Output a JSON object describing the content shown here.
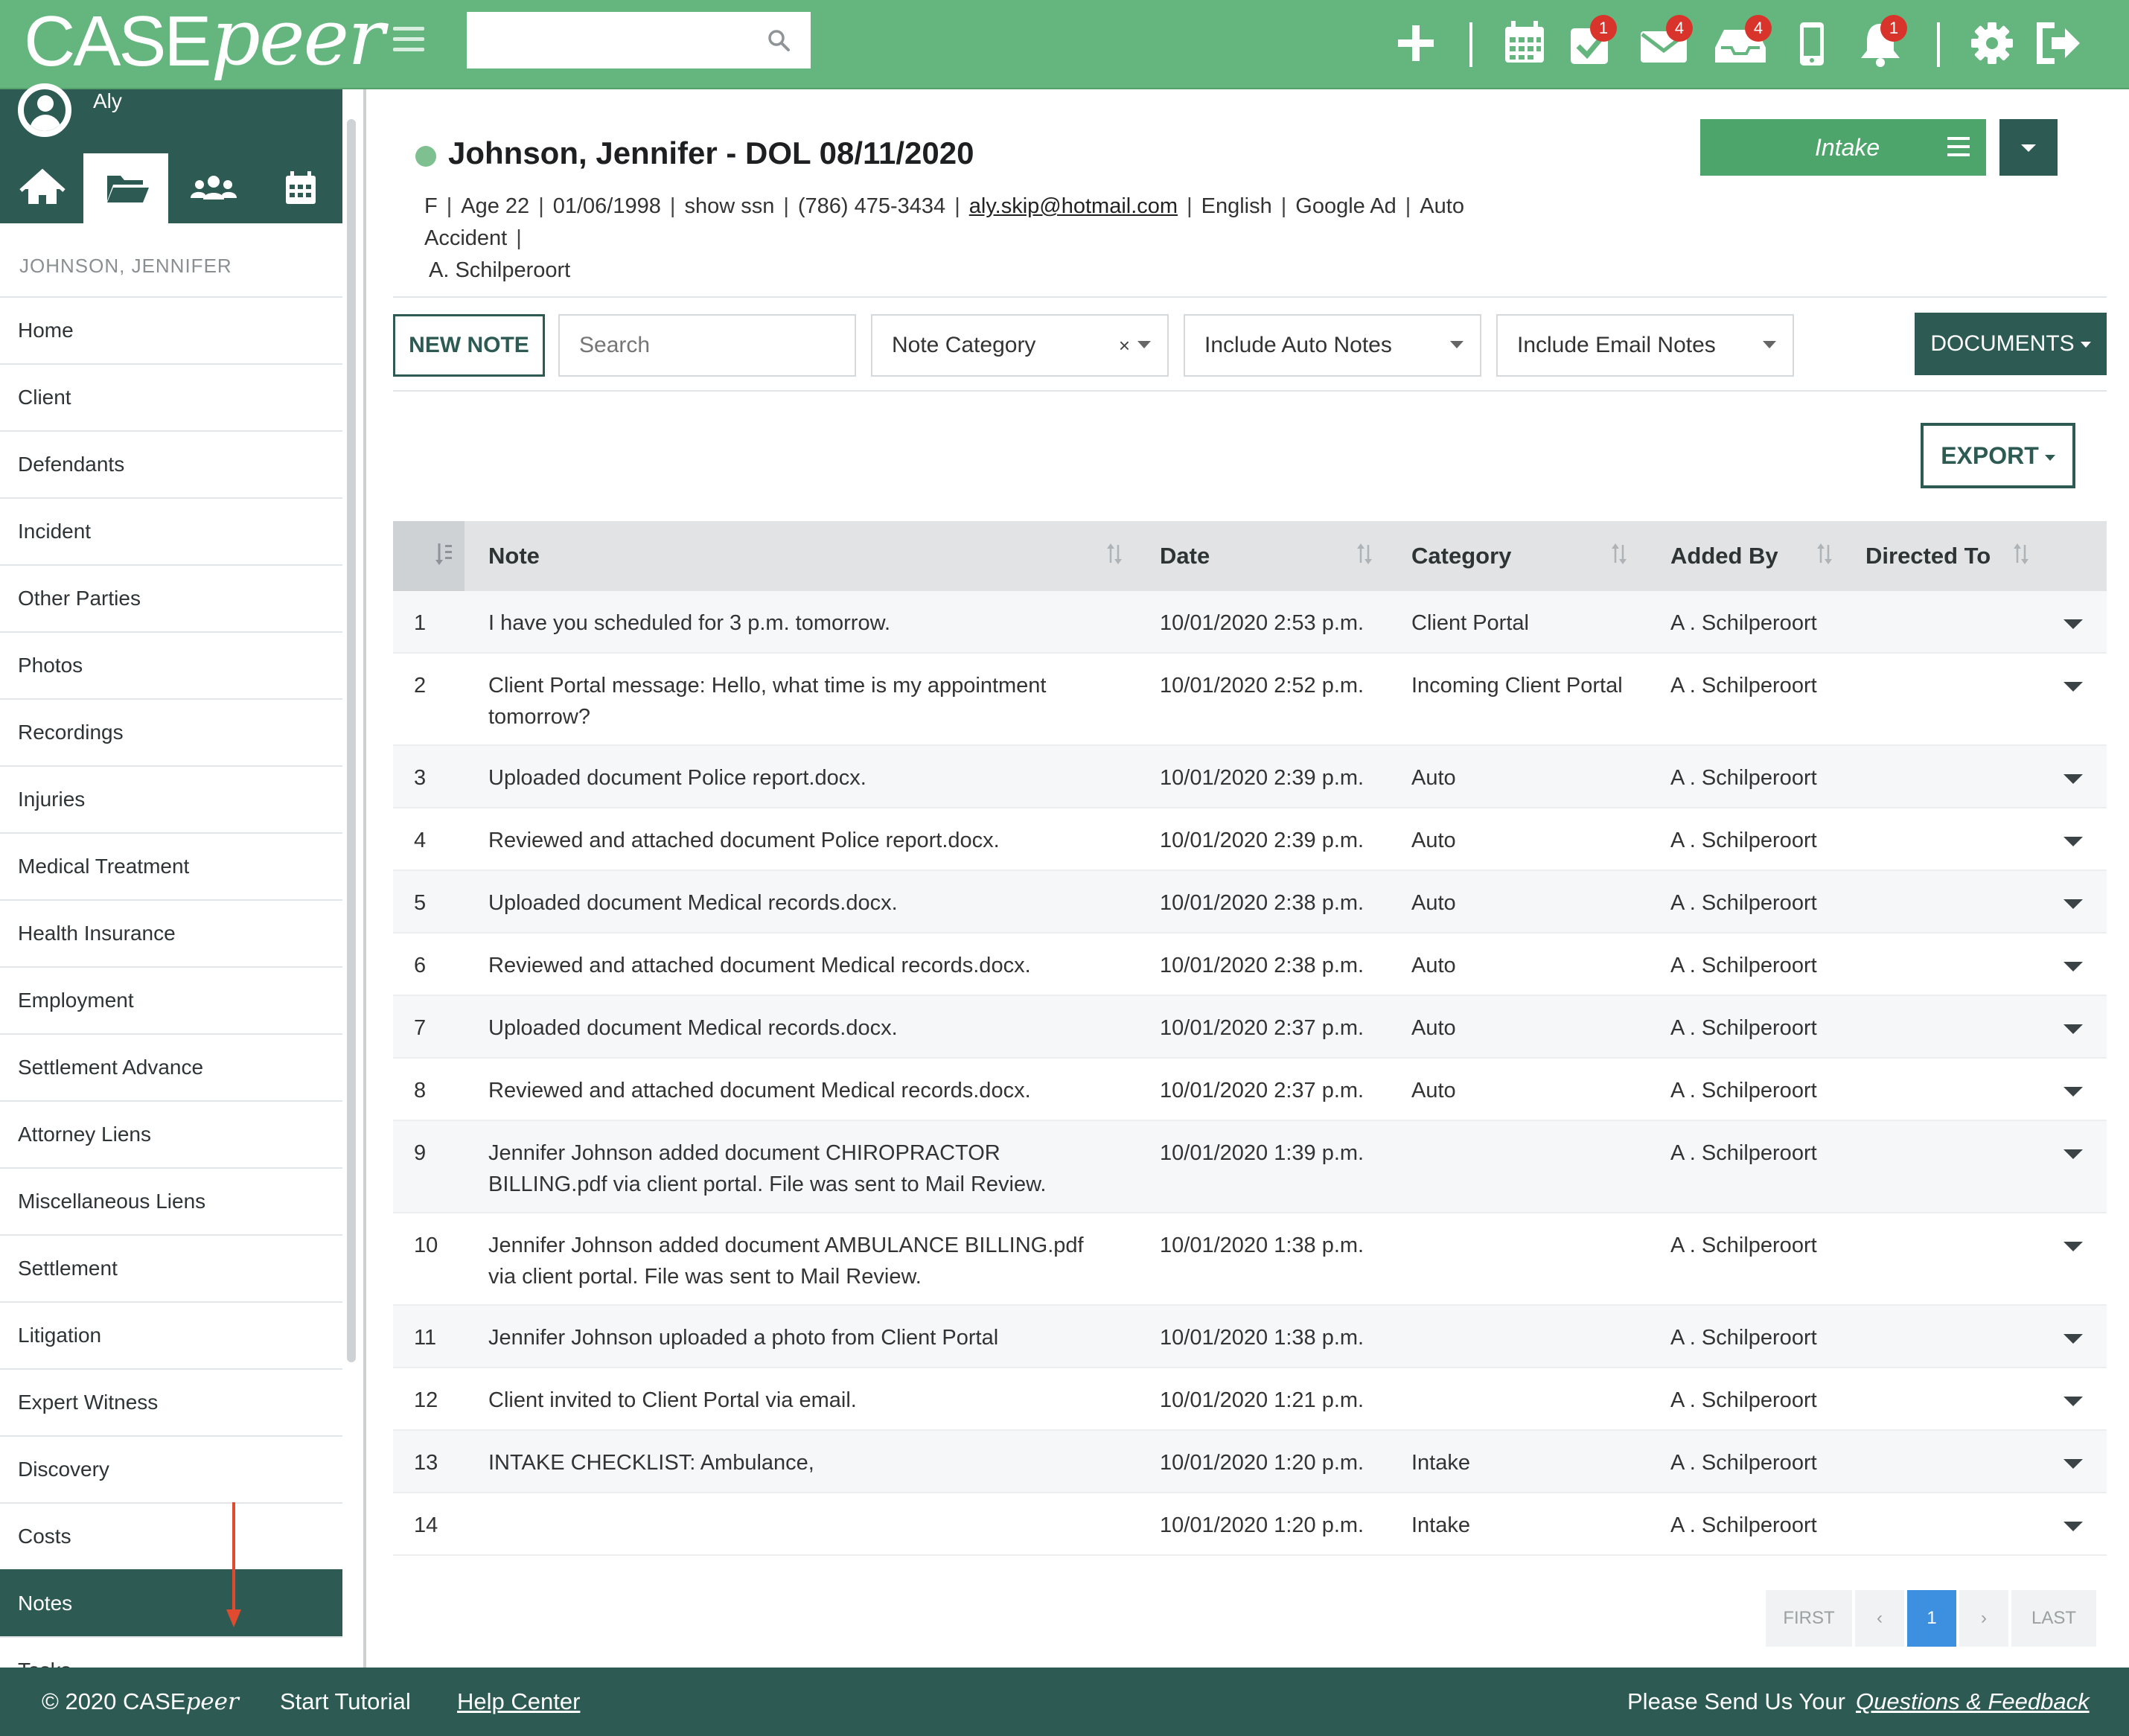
{
  "brand": {
    "logo_case": "CASE",
    "logo_peer": "peer"
  },
  "topbar": {
    "search_placeholder": "",
    "icons": [
      {
        "name": "add-icon",
        "badge": null
      },
      {
        "name": "calendar-icon",
        "badge": null
      },
      {
        "name": "tasks-icon",
        "badge": "1"
      },
      {
        "name": "mail-icon",
        "badge": "4"
      },
      {
        "name": "inbox-icon",
        "badge": "4"
      },
      {
        "name": "mobile-icon",
        "badge": null
      },
      {
        "name": "bell-icon",
        "badge": "1"
      },
      {
        "name": "gear-icon",
        "badge": null
      },
      {
        "name": "logout-icon",
        "badge": null
      }
    ],
    "colors": {
      "bar": "#65b57f",
      "dark": "#2d5b54",
      "badge": "#d9342b"
    }
  },
  "sidebar": {
    "user": "Aly",
    "case_name": "JOHNSON, JENNIFER",
    "tabs": [
      "home-icon",
      "folder-icon",
      "users-icon",
      "calendar-grid-icon"
    ],
    "active_tab": "folder-icon",
    "items": [
      "Home",
      "Client",
      "Defendants",
      "Incident",
      "Other Parties",
      "Photos",
      "Recordings",
      "Injuries",
      "Medical Treatment",
      "Health Insurance",
      "Employment",
      "Settlement Advance",
      "Attorney Liens",
      "Miscellaneous Liens",
      "Settlement",
      "Litigation",
      "Expert Witness",
      "Discovery",
      "Costs",
      "Notes",
      "Tasks"
    ],
    "active_item": "Notes"
  },
  "header": {
    "title": "Johnson, Jennifer - DOL 08/11/2020",
    "status_color": "#7ec08f",
    "meta": [
      "F",
      "Age 22",
      "01/06/1998",
      "show ssn",
      "(786) 475-3434",
      "aly.skip@hotmail.com",
      "English",
      "Google Ad",
      "Auto Accident",
      "A. Schilperoort"
    ],
    "stage": "Intake"
  },
  "toolbar": {
    "new_note": "NEW NOTE",
    "search_placeholder": "Search",
    "category": "Note Category",
    "category_clear": "×",
    "auto_notes": "Include Auto Notes",
    "email_notes": "Include Email Notes",
    "documents": "DOCUMENTS",
    "export": "EXPORT"
  },
  "table": {
    "headers": [
      "Note",
      "Date",
      "Category",
      "Added By",
      "Directed To"
    ],
    "rows": [
      {
        "n": "1",
        "note": "I have you scheduled for 3 p.m. tomorrow.",
        "date": "10/01/2020 2:53 p.m.",
        "category": "Client Portal",
        "added_by": "A . Schilperoort",
        "directed_to": ""
      },
      {
        "n": "2",
        "note": "Client Portal message: Hello, what time is my appointment tomorrow?",
        "date": "10/01/2020 2:52 p.m.",
        "category": "Incoming Client Portal",
        "added_by": "A . Schilperoort",
        "directed_to": ""
      },
      {
        "n": "3",
        "note": "Uploaded document Police report.docx.",
        "date": "10/01/2020 2:39 p.m.",
        "category": "Auto",
        "added_by": "A . Schilperoort",
        "directed_to": ""
      },
      {
        "n": "4",
        "note": "Reviewed and attached document Police report.docx.",
        "date": "10/01/2020 2:39 p.m.",
        "category": "Auto",
        "added_by": "A . Schilperoort",
        "directed_to": ""
      },
      {
        "n": "5",
        "note": "Uploaded document Medical records.docx.",
        "date": "10/01/2020 2:38 p.m.",
        "category": "Auto",
        "added_by": "A . Schilperoort",
        "directed_to": ""
      },
      {
        "n": "6",
        "note": "Reviewed and attached document Medical records.docx.",
        "date": "10/01/2020 2:38 p.m.",
        "category": "Auto",
        "added_by": "A . Schilperoort",
        "directed_to": ""
      },
      {
        "n": "7",
        "note": "Uploaded document Medical records.docx.",
        "date": "10/01/2020 2:37 p.m.",
        "category": "Auto",
        "added_by": "A . Schilperoort",
        "directed_to": ""
      },
      {
        "n": "8",
        "note": "Reviewed and attached document Medical records.docx.",
        "date": "10/01/2020 2:37 p.m.",
        "category": "Auto",
        "added_by": "A . Schilperoort",
        "directed_to": ""
      },
      {
        "n": "9",
        "note": "Jennifer Johnson added document CHIROPRACTOR BILLING.pdf via client portal. File was sent to Mail Review.",
        "date": "10/01/2020 1:39 p.m.",
        "category": "",
        "added_by": "A . Schilperoort",
        "directed_to": ""
      },
      {
        "n": "10",
        "note": "Jennifer Johnson added document AMBULANCE BILLING.pdf via client portal. File was sent to Mail Review.",
        "date": "10/01/2020 1:38 p.m.",
        "category": "",
        "added_by": "A . Schilperoort",
        "directed_to": ""
      },
      {
        "n": "11",
        "note": "Jennifer Johnson uploaded a photo from Client Portal",
        "date": "10/01/2020 1:38 p.m.",
        "category": "",
        "added_by": "A . Schilperoort",
        "directed_to": ""
      },
      {
        "n": "12",
        "note": "Client invited to Client Portal via email.",
        "date": "10/01/2020 1:21 p.m.",
        "category": "",
        "added_by": "A . Schilperoort",
        "directed_to": ""
      },
      {
        "n": "13",
        "note": "INTAKE CHECKLIST: Ambulance,",
        "date": "10/01/2020 1:20 p.m.",
        "category": "Intake",
        "added_by": "A . Schilperoort",
        "directed_to": ""
      },
      {
        "n": "14",
        "note": "",
        "date": "10/01/2020 1:20 p.m.",
        "category": "Intake",
        "added_by": "A . Schilperoort",
        "directed_to": ""
      }
    ]
  },
  "pager": {
    "first": "FIRST",
    "prev": "‹",
    "current": "1",
    "next": "›",
    "last": "LAST"
  },
  "footer": {
    "copyright": "© 2020 CASE",
    "copyright_peer": "peer",
    "tutorial": "Start Tutorial",
    "help": "Help Center",
    "feedback_prefix": "Please Send Us Your",
    "feedback_link": "Questions & Feedback"
  }
}
